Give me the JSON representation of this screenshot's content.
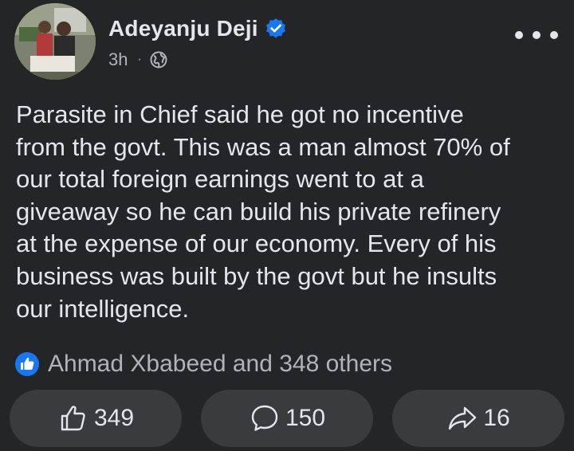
{
  "post": {
    "author": "Adeyanju Deji",
    "time": "3h",
    "separator": "·",
    "verified": true,
    "privacy_icon": "globe-icon",
    "text": "Parasite in Chief said he got no incentive\nfrom the govt. This was a man almost 70% of\nour total foreign earnings went to at a\ngiveaway so he can build his private refinery\nat the expense of our economy. Every of his\nbusiness was built by the govt but he insults\nour intelligence."
  },
  "reactions": {
    "summary": "Ahmad Xbabeed and 348 others",
    "icon": "like-icon"
  },
  "actions": {
    "like_count": "349",
    "comment_count": "150",
    "share_count": "16"
  },
  "colors": {
    "background": "#242526",
    "text": "#e4e6eb",
    "secondary_text": "#b0b3b8",
    "button_bg": "#3a3b3c",
    "accent": "#1877f2"
  }
}
